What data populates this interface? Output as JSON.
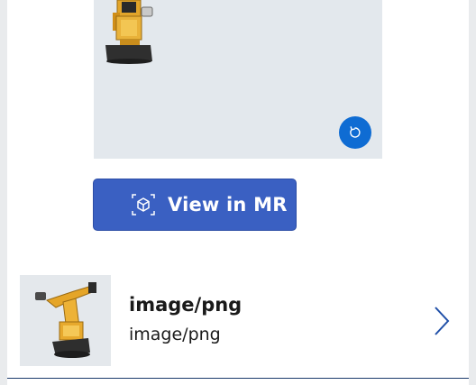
{
  "viewer": {
    "model_icon": "robot-arm-model",
    "reset_icon": "rotate-reset-icon"
  },
  "mr_button": {
    "label": "View in MR",
    "icon": "mixed-reality-cube-icon"
  },
  "gallery": {
    "items": [
      {
        "title": "image/png",
        "subtitle": "image/png",
        "thumbnail_icon": "robot-arm-thumbnail"
      }
    ],
    "chevron_icon": "chevron-right-icon"
  },
  "colors": {
    "accent": "#0f6cd3",
    "button": "#3a60c2",
    "viewer_bg": "#e3e8ed",
    "divider": "#1b3a6b"
  }
}
